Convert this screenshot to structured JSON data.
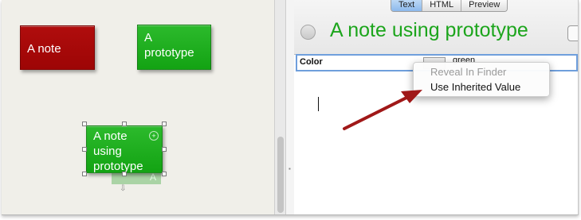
{
  "canvas": {
    "notes": [
      {
        "text": "A note",
        "color": "#aa0a0a"
      },
      {
        "text": "A prototype",
        "color": "#20b020"
      },
      {
        "text": "A note using prototype",
        "color": "#20b020"
      }
    ],
    "ghost_label": "A"
  },
  "view_tabs": [
    "Text",
    "HTML",
    "Preview"
  ],
  "active_tab": "Text",
  "note_title": "A note using prototype",
  "title_color": "#1ca51c",
  "attribute": {
    "name": "Color",
    "value": "green"
  },
  "context_menu": {
    "items": [
      {
        "label": "Reveal In Finder",
        "enabled": false
      },
      {
        "label": "Use Inherited Value",
        "enabled": true
      }
    ]
  },
  "annotation_arrow_color": "#a01818"
}
